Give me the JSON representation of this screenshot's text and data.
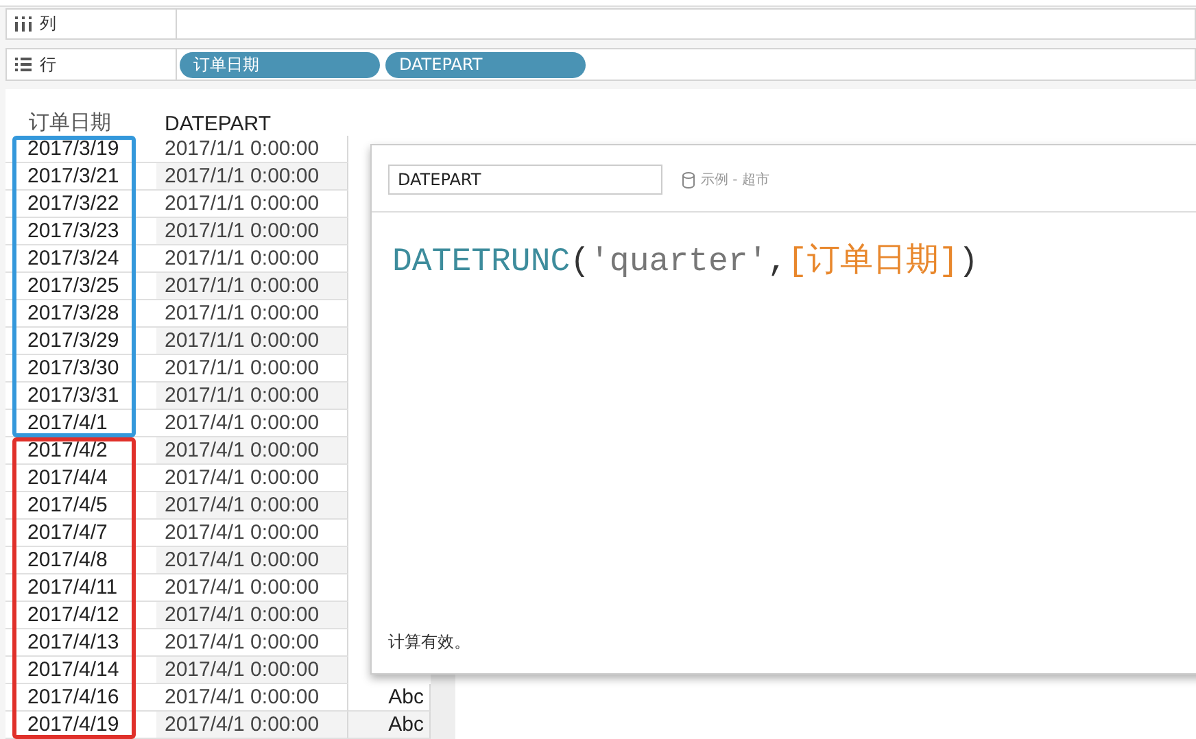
{
  "shelves": [
    {
      "kind": "columns",
      "label": "列"
    },
    {
      "kind": "rows",
      "label": "行",
      "pills": [
        "订单日期",
        "DATEPART"
      ]
    }
  ],
  "table": {
    "columns": [
      "订单日期",
      "DATEPART"
    ],
    "row_groups": [
      {
        "color": "#3498db",
        "rows": [
          {
            "date": "2017/3/19",
            "datepart": "2017/1/1 0:00:00"
          },
          {
            "date": "2017/3/21",
            "datepart": "2017/1/1 0:00:00"
          },
          {
            "date": "2017/3/22",
            "datepart": "2017/1/1 0:00:00"
          },
          {
            "date": "2017/3/23",
            "datepart": "2017/1/1 0:00:00"
          },
          {
            "date": "2017/3/24",
            "datepart": "2017/1/1 0:00:00"
          },
          {
            "date": "2017/3/25",
            "datepart": "2017/1/1 0:00:00"
          },
          {
            "date": "2017/3/28",
            "datepart": "2017/1/1 0:00:00"
          },
          {
            "date": "2017/3/29",
            "datepart": "2017/1/1 0:00:00"
          },
          {
            "date": "2017/3/30",
            "datepart": "2017/1/1 0:00:00"
          },
          {
            "date": "2017/3/31",
            "datepart": "2017/1/1 0:00:00"
          },
          {
            "date": "2017/4/1",
            "datepart": "2017/4/1 0:00:00"
          }
        ]
      },
      {
        "color": "#e0302a",
        "rows": [
          {
            "date": "2017/4/2",
            "datepart": "2017/4/1 0:00:00"
          },
          {
            "date": "2017/4/4",
            "datepart": "2017/4/1 0:00:00"
          },
          {
            "date": "2017/4/5",
            "datepart": "2017/4/1 0:00:00"
          },
          {
            "date": "2017/4/7",
            "datepart": "2017/4/1 0:00:00"
          },
          {
            "date": "2017/4/8",
            "datepart": "2017/4/1 0:00:00"
          },
          {
            "date": "2017/4/11",
            "datepart": "2017/4/1 0:00:00"
          },
          {
            "date": "2017/4/12",
            "datepart": "2017/4/1 0:00:00"
          },
          {
            "date": "2017/4/13",
            "datepart": "2017/4/1 0:00:00"
          },
          {
            "date": "2017/4/14",
            "datepart": "2017/4/1 0:00:00"
          },
          {
            "date": "2017/4/16",
            "datepart": "2017/4/1 0:00:00",
            "column_3": "Abc"
          },
          {
            "date": "2017/4/19",
            "datepart": "2017/4/1 0:00:00",
            "column_3": "Abc"
          }
        ]
      }
    ]
  },
  "calc_dialog": {
    "name": "DATEPART",
    "data_source": "示例 - 超市",
    "formula": [
      {
        "kind": "function",
        "text": "DATETRUNC"
      },
      {
        "kind": "punct",
        "text": "("
      },
      {
        "kind": "string",
        "text": "'quarter'"
      },
      {
        "kind": "punct",
        "text": ","
      },
      {
        "kind": "field",
        "text": "[订单日期]"
      },
      {
        "kind": "punct",
        "text": ")"
      }
    ],
    "status": "计算有效。"
  }
}
